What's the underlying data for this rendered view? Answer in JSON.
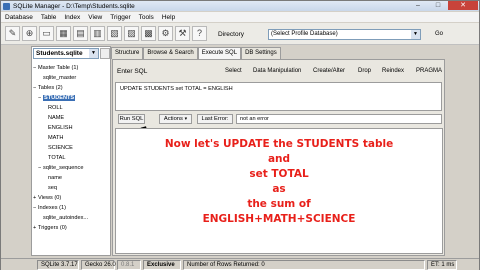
{
  "window": {
    "title": "SQLite Manager - D:\\Temp\\Students.sqlite",
    "controls": [
      "–",
      "□",
      "✕"
    ]
  },
  "menu": [
    "Database",
    "Table",
    "Index",
    "View",
    "Trigger",
    "Tools",
    "Help"
  ],
  "toolbar": {
    "directory_label": "Directory",
    "profile_select": "(Select Profile Database)",
    "go_label": "Go"
  },
  "sidebar": {
    "db_select": "Students.sqlite",
    "tree": [
      {
        "label": "Master Table (1)",
        "indent": 0,
        "prefix": "−"
      },
      {
        "label": "sqlite_master",
        "indent": 1,
        "prefix": ""
      },
      {
        "label": "Tables (2)",
        "indent": 0,
        "prefix": "−"
      },
      {
        "label": "STUDENTS",
        "indent": 1,
        "prefix": "−",
        "selected": true
      },
      {
        "label": "ROLL",
        "indent": 2,
        "prefix": ""
      },
      {
        "label": "NAME",
        "indent": 2,
        "prefix": ""
      },
      {
        "label": "ENGLISH",
        "indent": 2,
        "prefix": ""
      },
      {
        "label": "MATH",
        "indent": 2,
        "prefix": ""
      },
      {
        "label": "SCIENCE",
        "indent": 2,
        "prefix": ""
      },
      {
        "label": "TOTAL",
        "indent": 2,
        "prefix": ""
      },
      {
        "label": "sqlite_sequence",
        "indent": 1,
        "prefix": "−"
      },
      {
        "label": "name",
        "indent": 2,
        "prefix": ""
      },
      {
        "label": "seq",
        "indent": 2,
        "prefix": ""
      },
      {
        "label": "Views (0)",
        "indent": 0,
        "prefix": "+"
      },
      {
        "label": "Indexes (1)",
        "indent": 0,
        "prefix": "−"
      },
      {
        "label": "sqlite_autoindex...",
        "indent": 1,
        "prefix": ""
      },
      {
        "label": "Triggers (0)",
        "indent": 0,
        "prefix": "+"
      }
    ]
  },
  "tabs": [
    "Structure",
    "Browse & Search",
    "Execute SQL",
    "DB Settings"
  ],
  "sql": {
    "editor_label": "Enter SQL",
    "subtabs": [
      "Select",
      "Data Manipulation",
      "Create/Alter",
      "Drop",
      "Reindex",
      "PRAGMA"
    ],
    "statement": "UPDATE STUDENTS set TOTAL = ENGLISH",
    "run_label": "Run SQL",
    "actions_label": "Actions",
    "last_error_label": "Last Error:",
    "error_value": "not an error"
  },
  "overlay_lines": [
    "Now let's UPDATE the STUDENTS table",
    "and",
    "set TOTAL",
    "as",
    "the sum of",
    "ENGLISH+MATH+SCIENCE"
  ],
  "status": {
    "version": "SQLite 3.7.17",
    "gecko": "Gecko 26.0",
    "ext": "0.8.1",
    "mode": "Exclusive",
    "rows": "Number of Rows Returned: 0",
    "time": "ET: 1 ms"
  }
}
